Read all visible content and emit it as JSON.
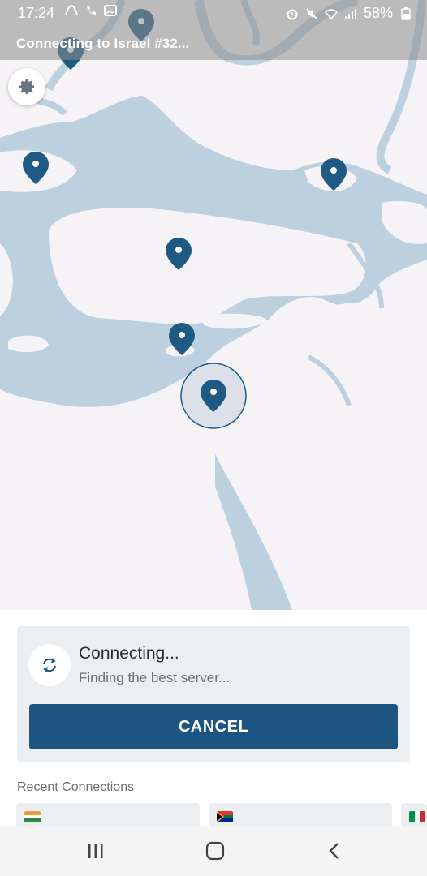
{
  "status_bar": {
    "time": "17:24",
    "battery": "58%",
    "icons": [
      "vpn-arc-icon",
      "wifi-call-icon",
      "image-icon",
      "alarm-icon",
      "mute-icon",
      "wifi-icon",
      "signal-icon",
      "battery-icon"
    ]
  },
  "banner": {
    "text": "Connecting to Israel #32..."
  },
  "settings": {
    "icon": "gear-icon"
  },
  "connection": {
    "title": "Connecting...",
    "subtitle": "Finding the best server...",
    "cancel_label": "CANCEL"
  },
  "recent": {
    "title": "Recent Connections",
    "items": [
      {
        "flag": "india-flag"
      },
      {
        "flag": "south-africa-flag"
      },
      {
        "flag": "italy-flag"
      }
    ]
  },
  "nav": {
    "recents": "recents-icon",
    "home": "home-icon",
    "back": "back-icon"
  },
  "colors": {
    "accent": "#1c5582",
    "water": "#bcd0e0",
    "land": "#f6f3f7",
    "pin": "#1f5a85"
  }
}
